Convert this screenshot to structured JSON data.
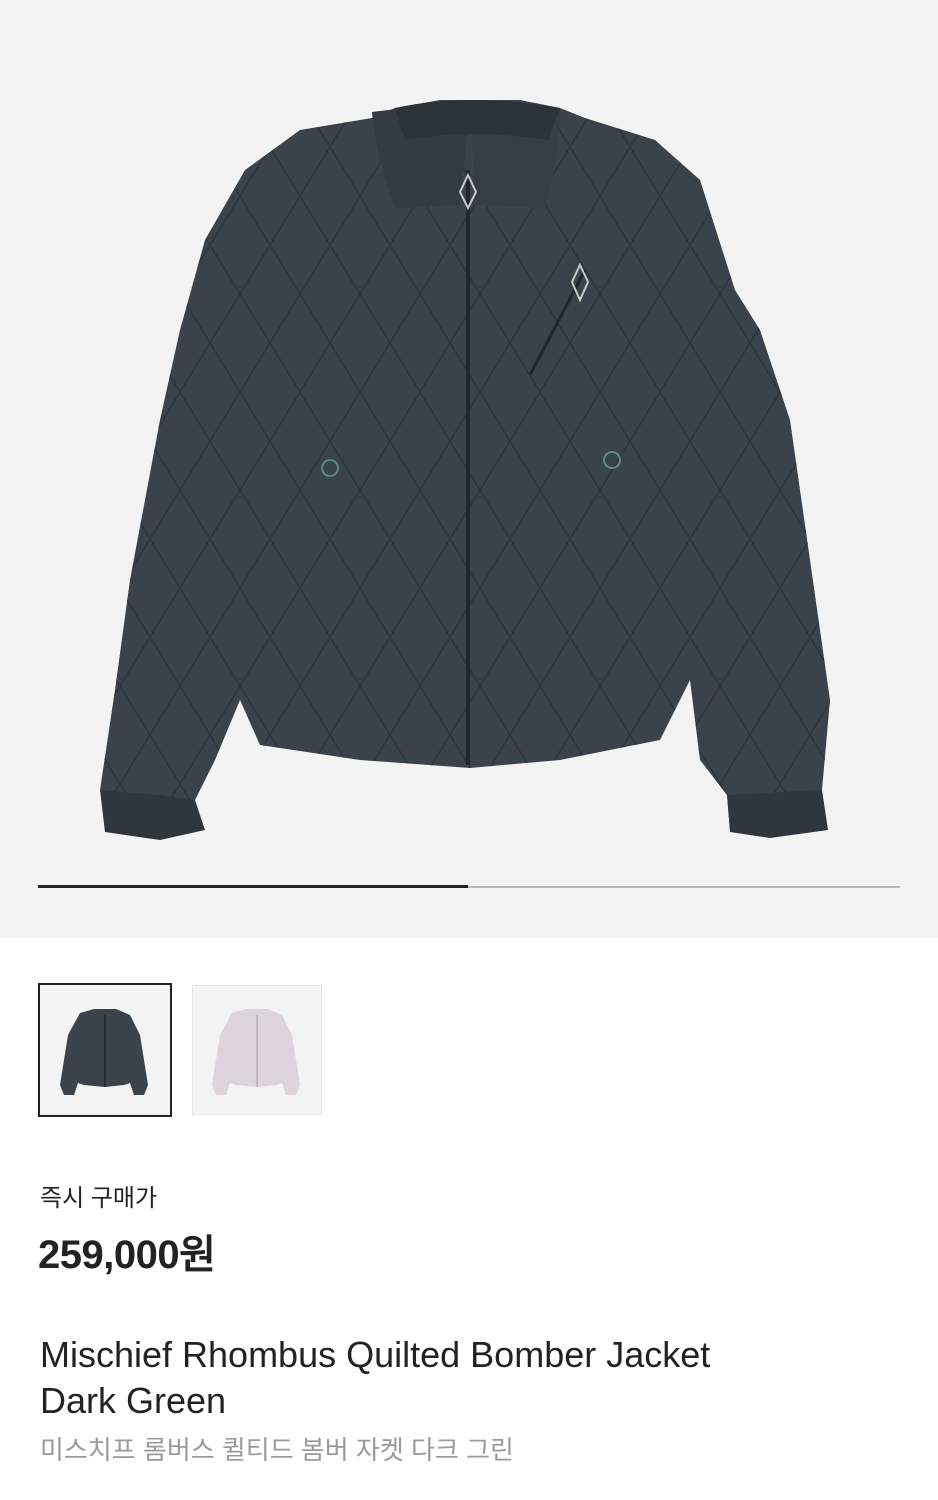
{
  "product": {
    "main_image": "quilted-bomber-jacket-navy",
    "gallery_progress": 0.5,
    "thumbnails": [
      {
        "name": "jacket-dark-green",
        "selected": true,
        "color": "#3a434c"
      },
      {
        "name": "jacket-light-pink",
        "selected": false,
        "color": "#ddd3da"
      }
    ],
    "price_label": "즉시 구매가",
    "price": "259,000원",
    "name_line1": "Mischief Rhombus Quilted Bomber Jacket",
    "name_line2": "Dark Green",
    "name_ko": "미스치프 롬버스 퀼티드 봄버 자켓 다크 그린"
  },
  "colors": {
    "hero_bg": "#f3f3f3",
    "jacket_main": "#3a434c",
    "jacket_alt": "#ddd3da",
    "text_primary": "#222222",
    "text_secondary": "#9a9a9a"
  }
}
